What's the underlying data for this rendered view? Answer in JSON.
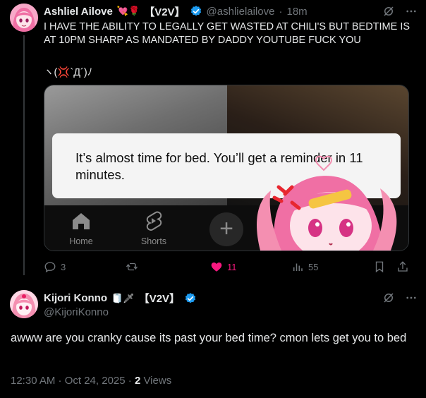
{
  "tweet1": {
    "author_name": "Ashliel Ailove",
    "author_emojis": "💘🌹",
    "author_tag": "【V2V】",
    "handle": "@ashlielailove",
    "separator": "·",
    "time": "18m",
    "text": "I HAVE THE ABILITY TO LEGALLY GET WASTED AT CHILI'S BUT BEDTIME IS AT 10PM SHARP AS MANDATED BY DADDY YOUTUBE FUCK YOU",
    "kaomoji": "ヽ(💢`Д´)ﾉ",
    "media": {
      "notice_text": "It’s almost time for bed. You’ll get a reminder in 11 minutes.",
      "nav_home": "Home",
      "nav_shorts": "Shorts",
      "nav_plus": "+"
    },
    "stats": {
      "replies": "3",
      "reposts": "",
      "likes": "11",
      "views": "55"
    }
  },
  "tweet2": {
    "author_name": "Kijori Konno",
    "author_emojis": "🧻🗡",
    "author_tag": "【V2V】",
    "handle": "@KijoriKonno",
    "text": "awww are you cranky cause its past your bed time? cmon lets get you to bed",
    "time": "12:30 AM · Oct 24, 2025 ·",
    "views_count": "2",
    "views_label": "Views"
  },
  "colors": {
    "background": "#000000",
    "text": "#e7e9ea",
    "muted": "#71767b",
    "like": "#f91880",
    "verified": "#1d9bf0",
    "border": "#2f3336"
  }
}
